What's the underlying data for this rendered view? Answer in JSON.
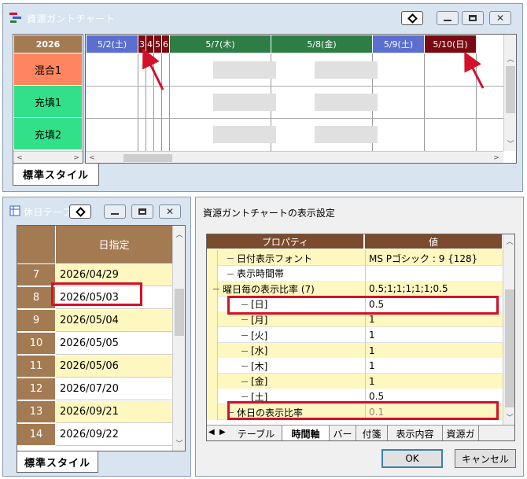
{
  "gantt": {
    "title": "資源ガントチャート",
    "year": "2026",
    "dates": [
      {
        "label": "5/2(土)",
        "kind": "sat"
      },
      {
        "label": "3",
        "kind": "hol"
      },
      {
        "label": "4",
        "kind": "hol"
      },
      {
        "label": "5",
        "kind": "hol"
      },
      {
        "label": "6",
        "kind": "hol"
      },
      {
        "label": "5/7(木)",
        "kind": "weekday"
      },
      {
        "label": "5/8(金)",
        "kind": "weekday"
      },
      {
        "label": "5/9(土)",
        "kind": "sat"
      },
      {
        "label": "5/10(日)",
        "kind": "sun"
      }
    ],
    "resources": [
      {
        "label": "混合1",
        "color": "#ff8560"
      },
      {
        "label": "充填1",
        "color": "#33e08a"
      },
      {
        "label": "充填2",
        "color": "#33e08a"
      }
    ],
    "tab": "標準スタイル"
  },
  "holiday": {
    "title": "休日テーブ",
    "column_header": "日指定",
    "rows": [
      {
        "no": "7",
        "date": "2026/04/29"
      },
      {
        "no": "8",
        "date": "2026/05/03"
      },
      {
        "no": "9",
        "date": "2026/05/04"
      },
      {
        "no": "10",
        "date": "2026/05/05"
      },
      {
        "no": "11",
        "date": "2026/05/06"
      },
      {
        "no": "12",
        "date": "2026/07/20"
      },
      {
        "no": "13",
        "date": "2026/09/21"
      },
      {
        "no": "14",
        "date": "2026/09/22"
      }
    ],
    "tab": "標準スタイル"
  },
  "settings": {
    "title": "資源ガントチャートの表示設定",
    "header_property": "プロパティ",
    "header_value": "値",
    "rows": [
      {
        "name": "日付表示フォント",
        "value": "MS Pゴシック : 9 {128}",
        "level": 1
      },
      {
        "name": "表示時間帯",
        "value": "",
        "level": 1
      },
      {
        "name": "曜日毎の表示比率 (7)",
        "value": "0.5;1;1;1;1;1;0.5",
        "level": 0
      },
      {
        "name": "[日]",
        "value": "0.5",
        "level": 2
      },
      {
        "name": "[月]",
        "value": "1",
        "level": 2
      },
      {
        "name": "[火]",
        "value": "1",
        "level": 2
      },
      {
        "name": "[水]",
        "value": "1",
        "level": 2
      },
      {
        "name": "[木]",
        "value": "1",
        "level": 2
      },
      {
        "name": "[金]",
        "value": "1",
        "level": 2
      },
      {
        "name": "[土]",
        "value": "0.5",
        "level": 2
      },
      {
        "name": "休日の表示比率",
        "value": "0.1",
        "level": 1
      }
    ],
    "tabs": [
      "テーブル",
      "時間軸",
      "バー",
      "付箋",
      "表示内容",
      "資源ガ"
    ],
    "active_tab": "時間軸",
    "ok_label": "OK",
    "cancel_label": "キャンセル"
  },
  "colors": {
    "sat": "#5a6fd0",
    "sun": "#7a0a12",
    "hol": "#7a0a12",
    "weekday": "#2e7d46",
    "year_header": "#a47a52",
    "row_even": "#fff7c0",
    "row_odd": "#ffffff",
    "highlight": "#d4102a"
  }
}
